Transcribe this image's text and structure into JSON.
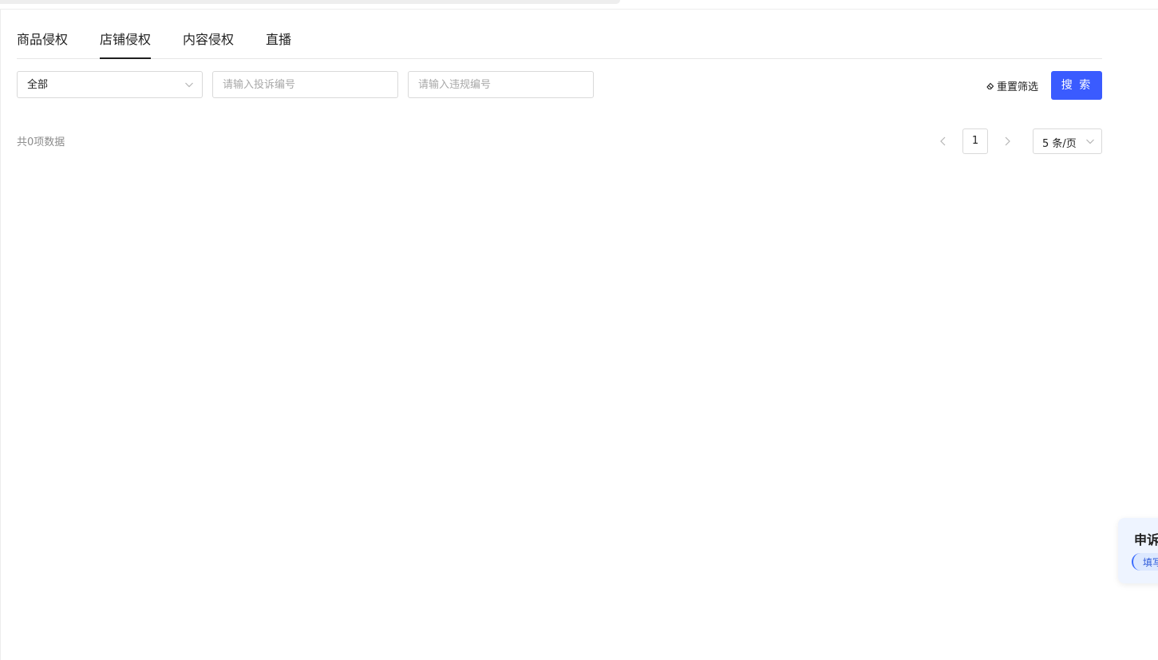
{
  "tabs": [
    {
      "label": "商品侵权",
      "active": false
    },
    {
      "label": "店铺侵权",
      "active": true
    },
    {
      "label": "内容侵权",
      "active": false
    },
    {
      "label": "直播",
      "active": false
    }
  ],
  "filters": {
    "category_select": {
      "value": "全部"
    },
    "complaint_no_input": {
      "value": "",
      "placeholder": "请输入投诉编号"
    },
    "violation_no_input": {
      "value": "",
      "placeholder": "请输入违规编号"
    },
    "reset_label": "重置筛选",
    "search_label": "搜 索"
  },
  "results": {
    "total_text": "共0项数据"
  },
  "pagination": {
    "current_page": "1",
    "page_size": "5 条/页"
  },
  "appeal_card": {
    "title": "申诉",
    "button_label": "填写"
  },
  "colors": {
    "accent": "#3a5bff",
    "text": "#1f1f1f",
    "muted": "#8c8c8c",
    "border": "#d9d9d9"
  },
  "icons": {
    "select_chevron": "chevron-down-icon",
    "reset": "eraser-icon",
    "prev": "chevron-left-icon",
    "next": "chevron-right-icon"
  }
}
